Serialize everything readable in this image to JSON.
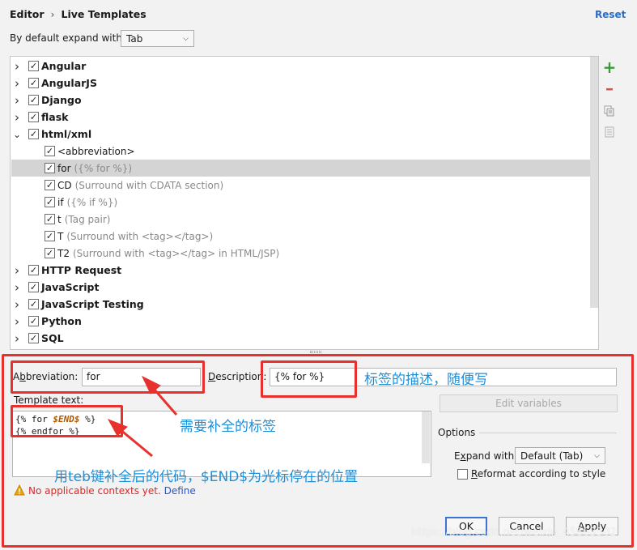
{
  "header": {
    "breadcrumb_root": "Editor",
    "breadcrumb_separator": "›",
    "breadcrumb_page": "Live Templates",
    "reset_label": "Reset",
    "expand_label": "By default expand with",
    "expand_value": "Tab"
  },
  "tree": {
    "groups": [
      {
        "name": "Angular",
        "checked": true,
        "expanded": false
      },
      {
        "name": "AngularJS",
        "checked": true,
        "expanded": false
      },
      {
        "name": "Django",
        "checked": true,
        "expanded": false
      },
      {
        "name": "flask",
        "checked": true,
        "expanded": false
      },
      {
        "name": "html/xml",
        "checked": true,
        "expanded": true,
        "templates": [
          {
            "abbr": "<abbreviation>",
            "desc": "",
            "selected": false
          },
          {
            "abbr": "for",
            "desc": "({% for %})",
            "selected": true
          },
          {
            "abbr": "CD",
            "desc": "(Surround with CDATA section)",
            "selected": false
          },
          {
            "abbr": "if",
            "desc": "({% if %})",
            "selected": false
          },
          {
            "abbr": "t",
            "desc": "(Tag pair)",
            "selected": false
          },
          {
            "abbr": "T",
            "desc": "(Surround with <tag></tag>)",
            "selected": false
          },
          {
            "abbr": "T2",
            "desc": "(Surround with <tag></tag> in HTML/JSP)",
            "selected": false
          }
        ]
      },
      {
        "name": "HTTP Request",
        "checked": true,
        "expanded": false
      },
      {
        "name": "JavaScript",
        "checked": true,
        "expanded": false
      },
      {
        "name": "JavaScript Testing",
        "checked": true,
        "expanded": false
      },
      {
        "name": "Python",
        "checked": true,
        "expanded": false
      },
      {
        "name": "SQL",
        "checked": true,
        "expanded": false
      }
    ]
  },
  "toolbar_icons": [
    "add-icon",
    "remove-icon",
    "copy-icon",
    "doc-icon"
  ],
  "form": {
    "abbreviation_label_pre": "A",
    "abbreviation_label_key": "b",
    "abbreviation_label_post": "breviation:",
    "abbreviation_value": "for",
    "description_label_pre": "",
    "description_label_key": "D",
    "description_label_post": "escription:",
    "description_value": "{% for %}",
    "template_text_label": "Template text:",
    "template_line1_pre": "{% for ",
    "template_line1_var": "$END$",
    "template_line1_post": " %}",
    "template_line2": "{% endfor %}",
    "edit_variables_label": "Edit variables",
    "options_label": "Options",
    "expand_with_label_pre": "E",
    "expand_with_label_key": "x",
    "expand_with_label_post": "pand with",
    "expand_with_value": "Default (Tab)",
    "reformat_label_key": "R",
    "reformat_label_post": "eformat according to style",
    "reformat_checked": false,
    "warning_text": "No applicable contexts yet.",
    "define_link": "Define"
  },
  "buttons": {
    "ok": "OK",
    "cancel": "Cancel",
    "apply_key": "A",
    "apply_post": "pply"
  },
  "annotations": {
    "description_note": "标签的描述，随便写",
    "abbreviation_note": "需要补全的标签",
    "template_note": "用teb键补全后的代码，$END$为光标停在的位置"
  },
  "watermark": "https://blog.csdn.net/weixin_45863502",
  "colors": {
    "accent": "#2b6cc4",
    "annotation_red": "#e8302c",
    "annotation_blue": "#1f8fd8",
    "warning_red": "#d7292a",
    "add_green": "#3a9a3a",
    "selection": "#d4d4d4"
  }
}
